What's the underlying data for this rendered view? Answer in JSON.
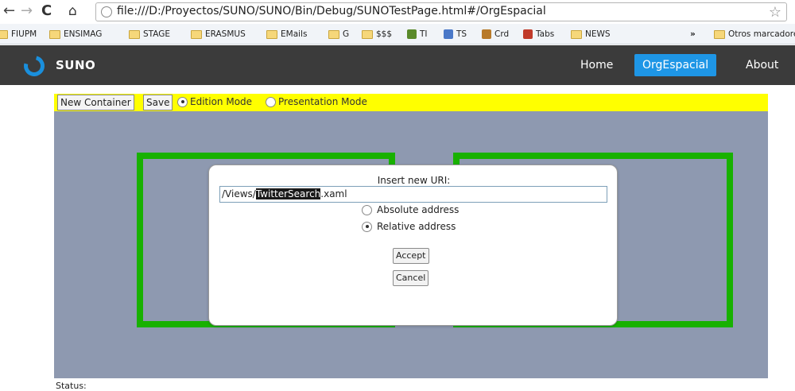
{
  "browser": {
    "url": "file:///D:/Proyectos/SUNO/SUNO/Bin/Debug/SUNOTestPage.html#/OrgEspacial",
    "bookmarks": [
      "FIUPM",
      "ENSIMAG",
      "STAGE",
      "ERASMUS",
      "EMails",
      "G",
      "$$$",
      "TI",
      "TS",
      "Crd",
      "Tabs",
      "NEWS"
    ],
    "overflow": "»",
    "other_bookmarks": "Otros marcadores"
  },
  "app": {
    "brand": "SUNO",
    "nav": {
      "home": "Home",
      "org": "OrgEspacial",
      "about": "About"
    },
    "accent": "#1e96e6"
  },
  "toolbar": {
    "new_container": "New Container",
    "save": "Save",
    "edition_mode": "Edition Mode",
    "presentation_mode": "Presentation Mode"
  },
  "dialog": {
    "title": "Insert new URI:",
    "uri_prefix": "/Views/",
    "uri_selected": "TwitterSearch",
    "uri_suffix": ".xaml",
    "absolute": "Absolute address",
    "relative": "Relative address",
    "accept": "Accept",
    "cancel": "Cancel"
  },
  "status": "Status:",
  "colors": {
    "container_border": "#18b100",
    "workspace": "#8e99b0",
    "toolbar": "#ffff00"
  }
}
